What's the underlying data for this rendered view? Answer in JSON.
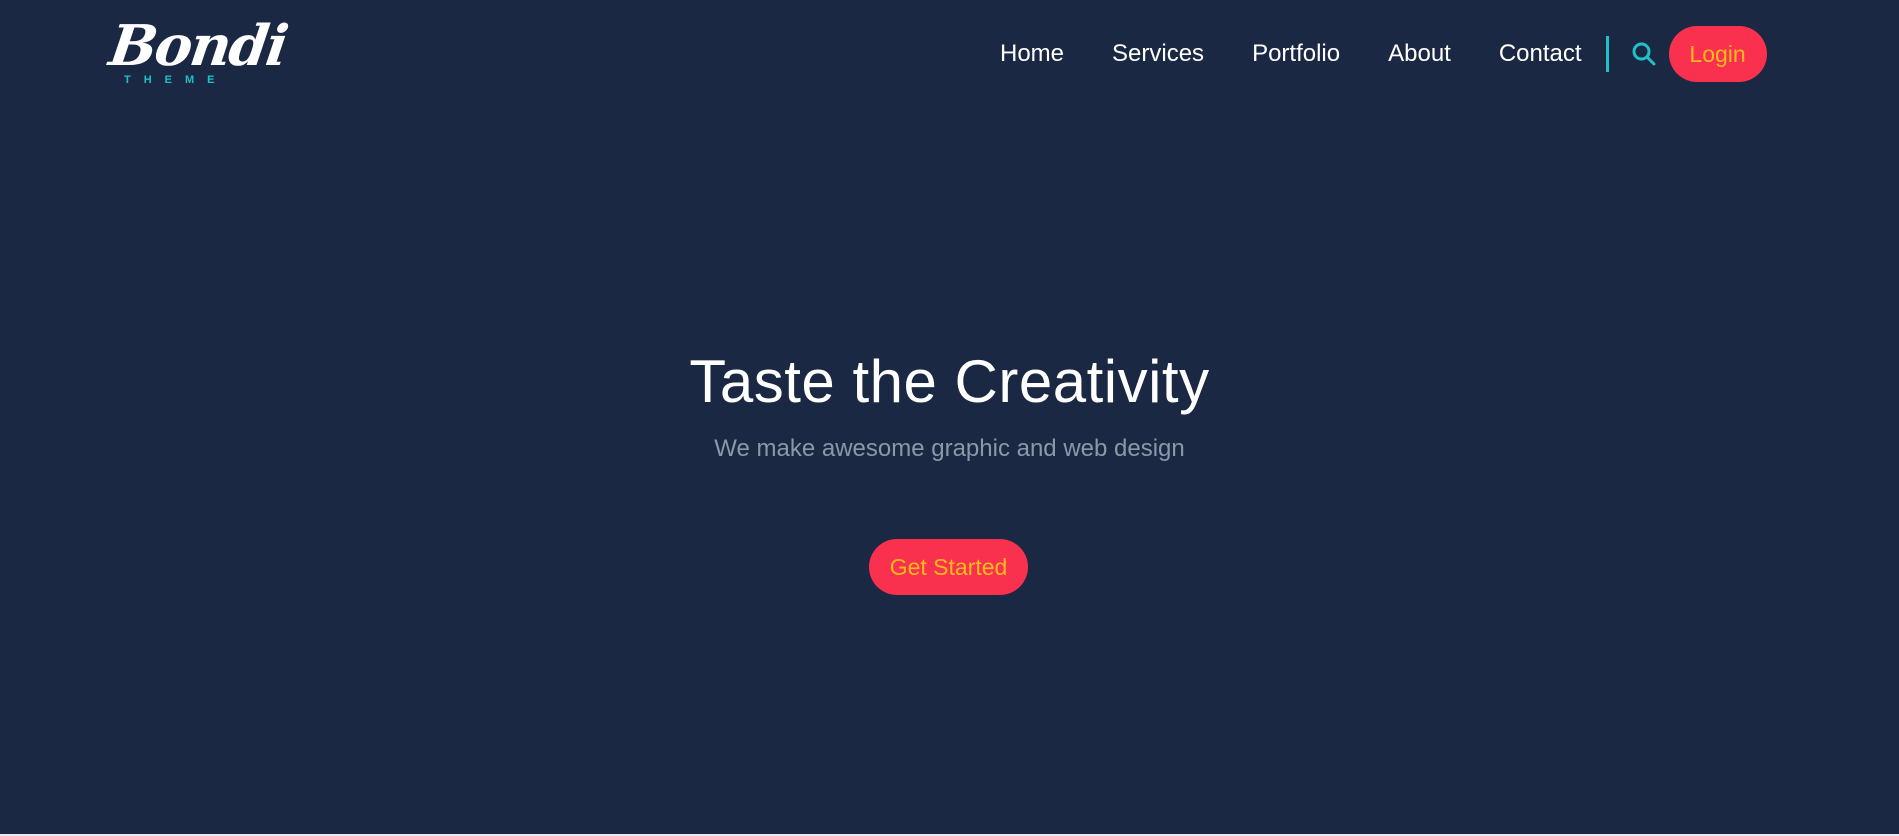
{
  "brand": {
    "name": "Bondi",
    "tagline": "THEME"
  },
  "nav": {
    "items": [
      {
        "label": "Home"
      },
      {
        "label": "Services"
      },
      {
        "label": "Portfolio"
      },
      {
        "label": "About"
      },
      {
        "label": "Contact"
      }
    ],
    "search_icon": "search-icon",
    "login_label": "Login"
  },
  "hero": {
    "title": "Taste the Creativity",
    "subtitle": "We make awesome graphic and web design",
    "cta_label": "Get Started"
  },
  "colors": {
    "background": "#1b2843",
    "accent_button": "#f9314e",
    "button_text": "#ffba1c",
    "teal": "#1ec0c9",
    "muted_text": "#8c98a8"
  }
}
